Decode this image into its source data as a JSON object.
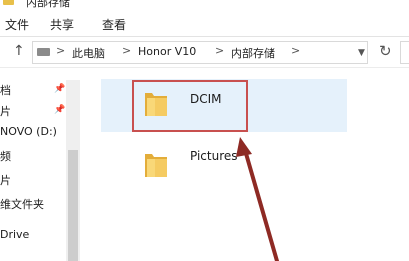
{
  "window": {
    "title": "内部存储"
  },
  "ribbon": {
    "tabs": [
      "文件",
      "共享",
      "查看"
    ]
  },
  "address_bar": {
    "crumbs": [
      "此电脑",
      "Honor V10",
      "内部存储"
    ],
    "separator": ">"
  },
  "nav_pane": {
    "items": [
      {
        "label": "档",
        "pinned": true
      },
      {
        "label": "片",
        "pinned": true
      },
      {
        "label": "NOVO (D:)",
        "pinned": false
      },
      {
        "label": "频",
        "pinned": false
      },
      {
        "label": "片",
        "pinned": false
      },
      {
        "label": "维文件夹",
        "pinned": false
      },
      {
        "label": "Drive",
        "pinned": false
      }
    ]
  },
  "files": [
    {
      "name": "DCIM",
      "type": "folder",
      "selected": true,
      "highlighted": true
    },
    {
      "name": "Pictures",
      "type": "folder",
      "selected": false,
      "highlighted": false
    }
  ],
  "colors": {
    "selection_bg": "#e5f1fb",
    "highlight_box": "#c8504f",
    "arrow": "#8e2a24",
    "folder": "#f2c45a"
  }
}
